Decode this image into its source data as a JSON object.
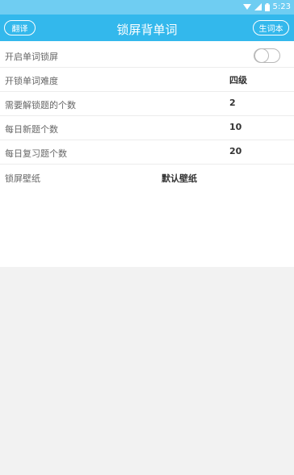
{
  "status_bar": {
    "time": "5:23",
    "icons": [
      "wifi-icon",
      "signal-icon",
      "battery-icon"
    ]
  },
  "header": {
    "left_button": "翻译",
    "title": "锁屏背单词",
    "right_button": "生词本"
  },
  "settings": [
    {
      "label": "开启单词锁屏",
      "control": "toggle",
      "enabled": false
    },
    {
      "label": "开锁单词难度",
      "value": "四级"
    },
    {
      "label": "需要解锁题的个数",
      "value": "2"
    },
    {
      "label": "每日新题个数",
      "value": "10"
    },
    {
      "label": "每日复习题个数",
      "value": "20"
    },
    {
      "label": "锁屏壁纸",
      "value": "默认壁纸"
    }
  ],
  "colors": {
    "header": "#33b8ec",
    "status_bar": "#6fcdf2",
    "background": "#f2f2f2"
  }
}
